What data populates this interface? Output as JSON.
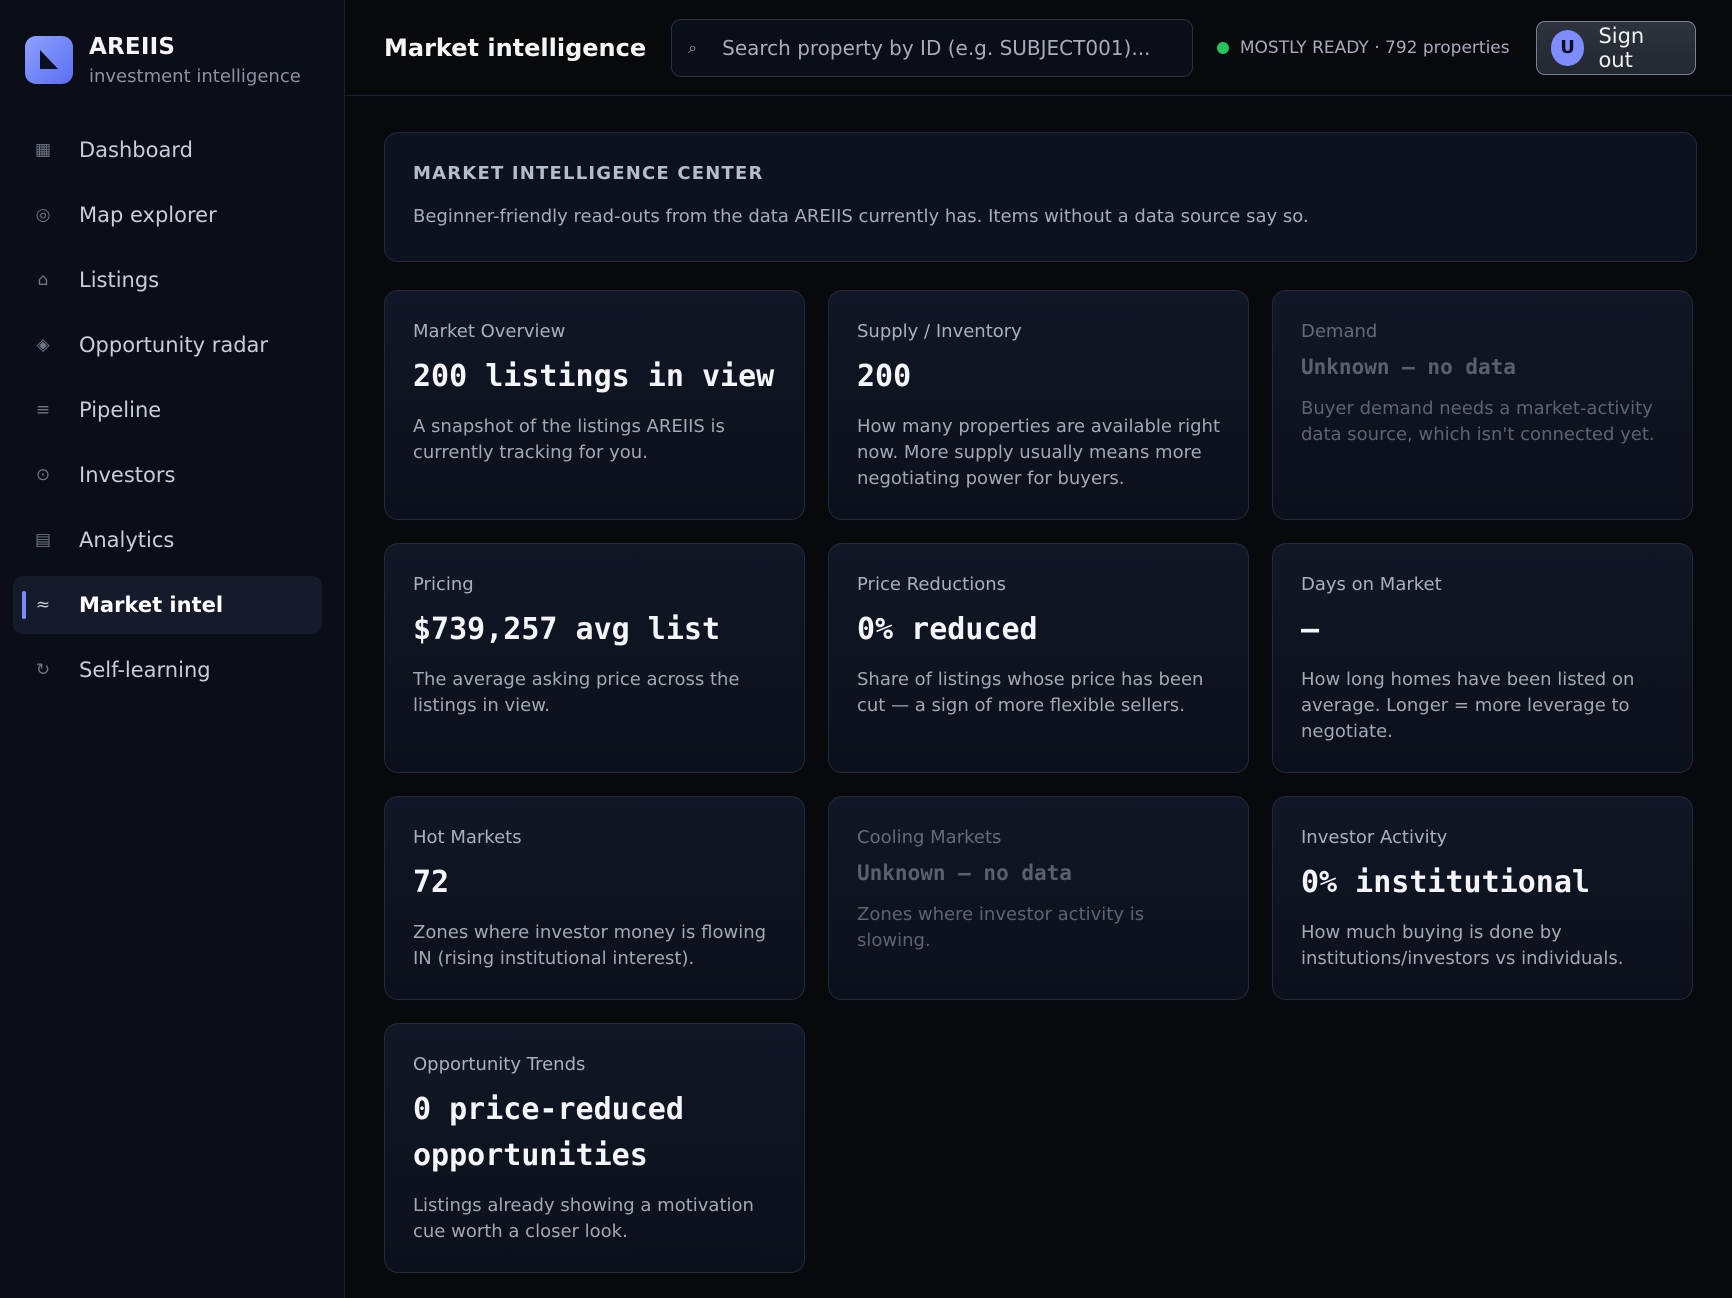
{
  "brand": {
    "name": "AREIIS",
    "subtitle": "investment intelligence"
  },
  "sidebar": {
    "items": [
      {
        "label": "Dashboard",
        "icon": "dashboard-icon",
        "glyph": "▦"
      },
      {
        "label": "Map explorer",
        "icon": "map-icon",
        "glyph": "◎"
      },
      {
        "label": "Listings",
        "icon": "home-icon",
        "glyph": "⌂"
      },
      {
        "label": "Opportunity radar",
        "icon": "radar-icon",
        "glyph": "◈"
      },
      {
        "label": "Pipeline",
        "icon": "pipeline-icon",
        "glyph": "≡"
      },
      {
        "label": "Investors",
        "icon": "investors-icon",
        "glyph": "⊙"
      },
      {
        "label": "Analytics",
        "icon": "analytics-icon",
        "glyph": "▤"
      },
      {
        "label": "Market intel",
        "icon": "market-intel-icon",
        "glyph": "≈",
        "active": true
      },
      {
        "label": "Self-learning",
        "icon": "refresh-icon",
        "glyph": "↻"
      }
    ]
  },
  "header": {
    "title": "Market intelligence",
    "search_placeholder": "Search property by ID (e.g. SUBJECT001)...",
    "search_icon": "search-icon",
    "status_text": "MOSTLY READY · 792 properties",
    "status_color": "#22c55e",
    "avatar_initial": "U",
    "signout_label": "Sign out"
  },
  "hero": {
    "title": "MARKET INTELLIGENCE CENTER",
    "description": "Beginner-friendly read-outs from the data AREIIS currently has. Items without a data source say so."
  },
  "cards": [
    {
      "label": "Market Overview",
      "value": "200 listings in view",
      "description": "A snapshot of the listings AREIIS is currently tracking for you."
    },
    {
      "label": "Supply / Inventory",
      "value": "200",
      "description": "How many properties are available right now. More supply usually means more negotiating power for buyers."
    },
    {
      "label": "Demand",
      "value": "Unknown — no data",
      "description": "Buyer demand needs a market-activity data source, which isn't connected yet."
    },
    {
      "label": "Pricing",
      "value": "$739,257 avg list",
      "description": "The average asking price across the listings in view."
    },
    {
      "label": "Price Reductions",
      "value": "0% reduced",
      "description": "Share of listings whose price has been cut — a sign of more flexible sellers."
    },
    {
      "label": "Days on Market",
      "value": "—",
      "description": "How long homes have been listed on average. Longer = more leverage to negotiate."
    },
    {
      "label": "Hot Markets",
      "value": "72",
      "description": "Zones where investor money is flowing IN (rising institutional interest)."
    },
    {
      "label": "Cooling Markets",
      "value": "Unknown — no data",
      "description": "Zones where investor activity is slowing."
    },
    {
      "label": "Investor Activity",
      "value": "0% institutional",
      "description": "How much buying is done by institutions/investors vs individuals."
    },
    {
      "label": "Opportunity Trends",
      "value": "0 price-reduced opportunities",
      "description": "Listings already showing a motivation cue worth a closer look."
    }
  ]
}
